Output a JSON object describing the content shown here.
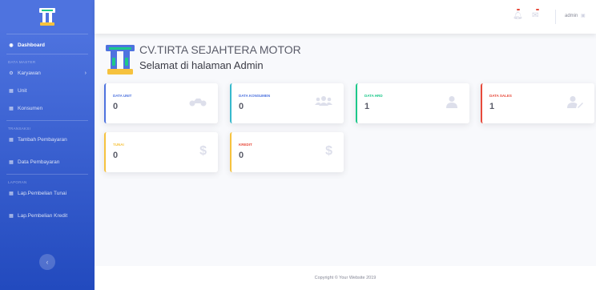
{
  "colors": {
    "primary": "#4e73df",
    "info": "#36b9cc",
    "success": "#1cc88a",
    "danger": "#e74a3b",
    "warning": "#f6c23e"
  },
  "sidebar": {
    "brand_icon": "tirta-logo-icon",
    "dashboard": {
      "label": "Dashboard",
      "icon": "dashboard-icon"
    },
    "heading_master": "DATA MASTER",
    "karyawan": {
      "label": "Karyawan",
      "icon": "gear-icon"
    },
    "unit": {
      "label": "Unit",
      "icon": "table-icon"
    },
    "konsumen": {
      "label": "Konsumen",
      "icon": "table-icon"
    },
    "heading_transaksi": "TRANSAKSI",
    "tambah_pembayaran": {
      "label": "Tambah Pembayaran",
      "icon": "table-icon"
    },
    "data_pembayaran": {
      "label": "Data Pembayaran",
      "icon": "table-icon"
    },
    "heading_laporan": "LAPORAN",
    "lap_tunai": {
      "label": "Lap.Pembelian Tunai",
      "icon": "table-icon"
    },
    "lap_kredit": {
      "label": "Lap.Pembelian Kredit",
      "icon": "table-icon"
    },
    "toggle_icon": "chevron-left-icon"
  },
  "topbar": {
    "alerts_badge": "",
    "messages_badge": "",
    "user_name": "admin"
  },
  "heading": {
    "company": "CV.TIRTA SEJAHTERA MOTOR",
    "welcome": "Selamat di halaman Admin"
  },
  "cards": {
    "unit": {
      "label": "DATA UNIT",
      "value": "0",
      "icon": "motorcycle-icon"
    },
    "konsumen": {
      "label": "DATA KONSUMEN",
      "value": "0",
      "icon": "users-icon"
    },
    "hrd": {
      "label": "DATA HRD",
      "value": "1",
      "icon": "user-icon"
    },
    "sales": {
      "label": "DATA SALES",
      "value": "1",
      "icon": "user-edit-icon"
    },
    "tunai": {
      "label": "TUNAI",
      "value": "0",
      "icon": "dollar-icon"
    },
    "kredit": {
      "label": "KREDIT",
      "value": "0",
      "icon": "dollar-icon"
    }
  },
  "footer": {
    "copyright": "Copyright © Your Website 2019"
  }
}
